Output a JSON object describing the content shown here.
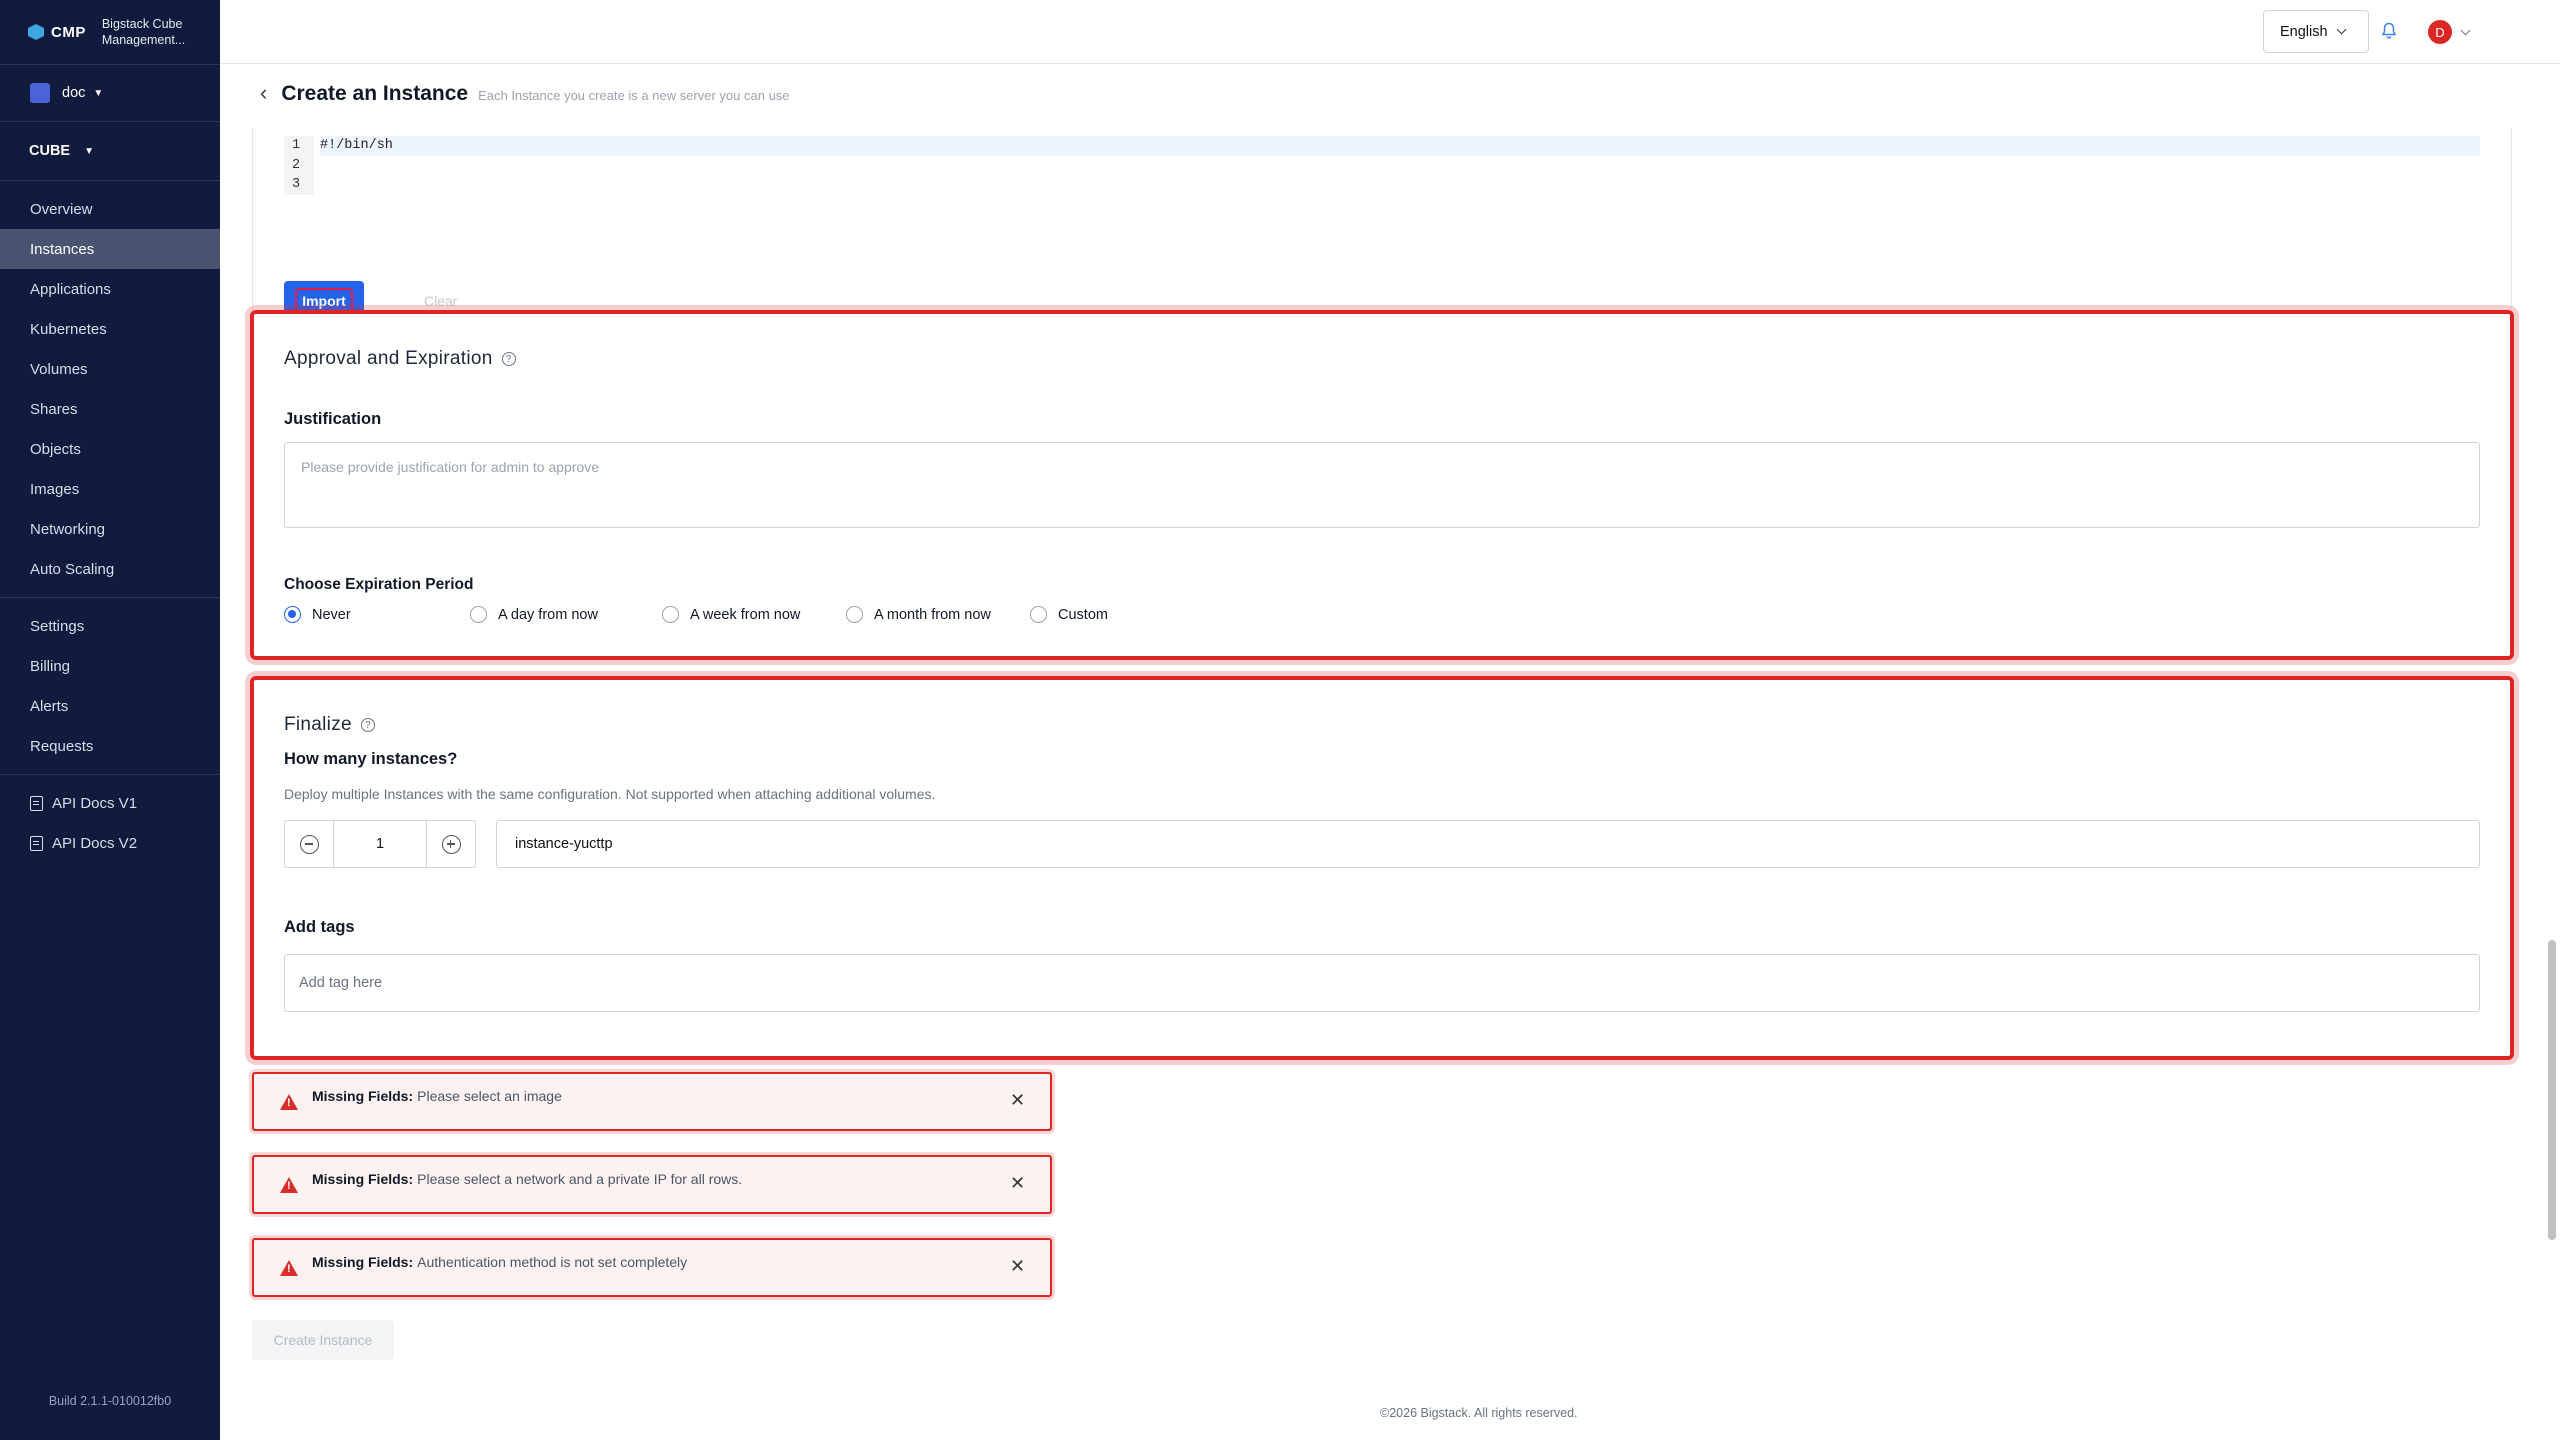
{
  "app": {
    "short_name": "CMP",
    "full_name": "Bigstack Cube Management..."
  },
  "project": {
    "name": "doc"
  },
  "region": {
    "name": "CUBE"
  },
  "nav": {
    "items": [
      {
        "label": "Overview"
      },
      {
        "label": "Instances"
      },
      {
        "label": "Applications"
      },
      {
        "label": "Kubernetes"
      },
      {
        "label": "Volumes"
      },
      {
        "label": "Shares"
      },
      {
        "label": "Objects"
      },
      {
        "label": "Images"
      },
      {
        "label": "Networking"
      },
      {
        "label": "Auto Scaling"
      }
    ],
    "admin_items": [
      {
        "label": "Settings"
      },
      {
        "label": "Billing"
      },
      {
        "label": "Alerts"
      },
      {
        "label": "Requests"
      }
    ],
    "docs": [
      {
        "label": "API Docs V1"
      },
      {
        "label": "API Docs V2"
      }
    ],
    "active": "Instances"
  },
  "build": "Build 2.1.1-010012fb0",
  "topbar": {
    "language": "English",
    "avatar_initial": "D"
  },
  "header": {
    "title": "Create an Instance",
    "subtitle": "Each Instance you create is a new server you can use"
  },
  "script_editor": {
    "line_numbers": [
      "1",
      "2",
      "3"
    ],
    "code": "#!/bin/sh",
    "import_label": "Import",
    "clear_label": "Clear"
  },
  "approval": {
    "title": "Approval and Expiration",
    "justification_label": "Justification",
    "justification_placeholder": "Please provide justification for admin to approve",
    "expiration_label": "Choose Expiration Period",
    "options": [
      "Never",
      "A day from now",
      "A week from now",
      "A month from now",
      "Custom"
    ],
    "selected": "Never"
  },
  "finalize": {
    "title": "Finalize",
    "count_label": "How many instances?",
    "count_hint": "Deploy multiple Instances with the same configuration. Not supported when attaching additional volumes.",
    "count": "1",
    "instance_name": "instance-yucttp",
    "tags_label": "Add tags",
    "tags_placeholder": "Add tag here"
  },
  "alerts": [
    {
      "prefix": "Missing Fields:",
      "message": "Please select an image"
    },
    {
      "prefix": "Missing Fields:",
      "message": "Please select a network and a private IP for all rows."
    },
    {
      "prefix": "Missing Fields:",
      "message": "Authentication method is not set completely"
    }
  ],
  "create_label": "Create Instance",
  "footer": "©2026 Bigstack. All rights reserved.",
  "colors": {
    "sidebar": "#111b3d",
    "accent": "#2563eb",
    "error": "#e02424"
  }
}
